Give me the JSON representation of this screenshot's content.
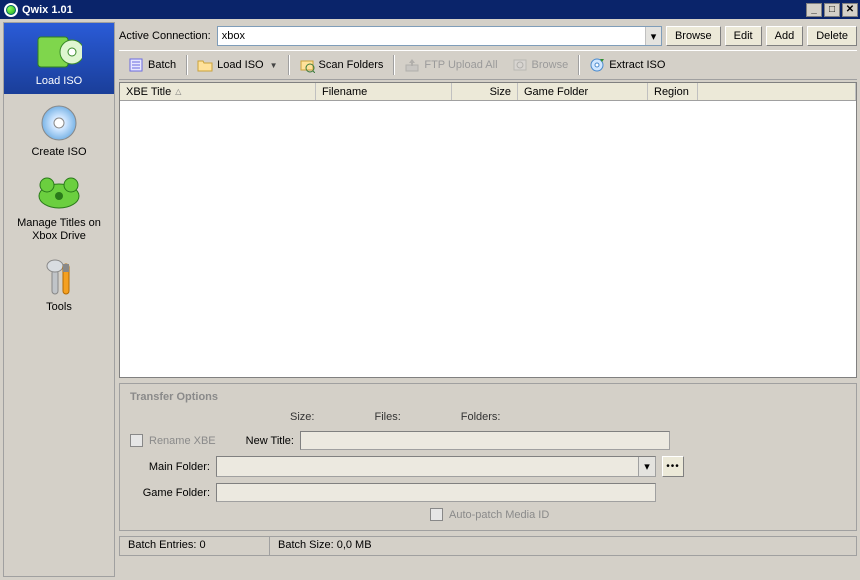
{
  "window": {
    "title": "Qwix 1.01"
  },
  "sidebar": {
    "items": [
      {
        "label": "Load ISO",
        "selected": true
      },
      {
        "label": "Create ISO"
      },
      {
        "label": "Manage Titles on Xbox Drive"
      },
      {
        "label": "Tools"
      }
    ]
  },
  "connection": {
    "label": "Active Connection:",
    "value": "xbox",
    "buttons": {
      "browse": "Browse",
      "edit": "Edit",
      "add": "Add",
      "delete": "Delete"
    }
  },
  "toolbar": {
    "batch": "Batch",
    "load_iso": "Load ISO",
    "scan_folders": "Scan Folders",
    "ftp_upload_all": "FTP Upload All",
    "browse": "Browse",
    "extract_iso": "Extract ISO"
  },
  "grid": {
    "columns": {
      "xbe": "XBE Title",
      "filename": "Filename",
      "size": "Size",
      "game_folder": "Game Folder",
      "region": "Region"
    }
  },
  "transfer": {
    "title": "Transfer Options",
    "stats": {
      "size": "Size:",
      "files": "Files:",
      "folders": "Folders:"
    },
    "rename_xbe": "Rename XBE",
    "new_title": "New Title:",
    "main_folder": "Main Folder:",
    "game_folder": "Game Folder:",
    "auto_patch": "Auto-patch Media ID"
  },
  "status": {
    "batch_entries": "Batch Entries: 0",
    "batch_size": "Batch Size: 0,0 MB"
  }
}
